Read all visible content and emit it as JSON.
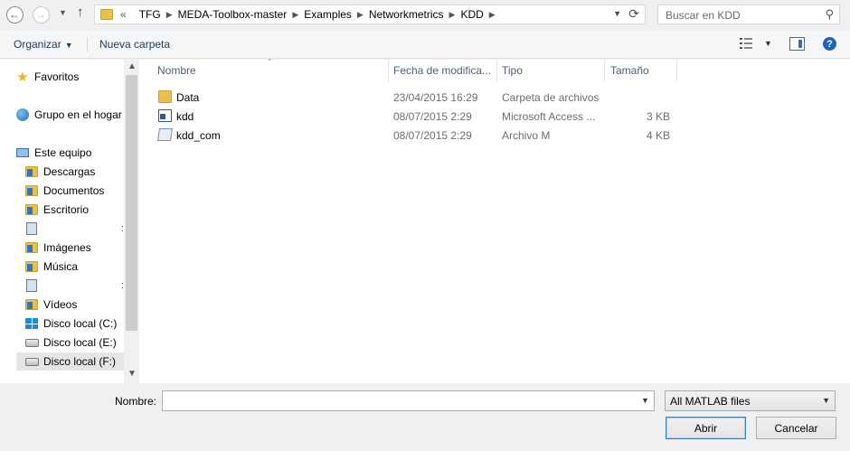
{
  "address_bar": {
    "overflow": "«",
    "crumbs": [
      "TFG",
      "MEDA-Toolbox-master",
      "Examples",
      "Networkmetrics",
      "KDD"
    ]
  },
  "search": {
    "placeholder": "Buscar en KDD"
  },
  "toolbar": {
    "organize_label": "Organizar",
    "new_folder_label": "Nueva carpeta"
  },
  "nav": {
    "favorites": "Favoritos",
    "homegroup": "Grupo en el hogar",
    "this_pc": "Este equipo",
    "items": [
      {
        "label": "Descargas",
        "icon": "downloads-folder-icon"
      },
      {
        "label": "Documentos",
        "icon": "documents-folder-icon"
      },
      {
        "label": "Escritorio",
        "icon": "desktop-folder-icon"
      },
      {
        "label": "",
        "icon": "network-location-icon"
      },
      {
        "label": "Imágenes",
        "icon": "pictures-folder-icon"
      },
      {
        "label": "Música",
        "icon": "music-folder-icon"
      },
      {
        "label": "",
        "icon": "network-location-icon"
      },
      {
        "label": "Vídeos",
        "icon": "videos-folder-icon"
      },
      {
        "label": "Disco local (C:)",
        "icon": "windows-drive-icon"
      },
      {
        "label": "Disco local (E:)",
        "icon": "drive-icon"
      },
      {
        "label": "Disco local (F:)",
        "icon": "drive-icon"
      }
    ]
  },
  "columns": {
    "name": "Nombre",
    "date": "Fecha de modifica...",
    "type": "Tipo",
    "size": "Tamaño"
  },
  "files": [
    {
      "name": "Data",
      "date": "23/04/2015 16:29",
      "type": "Carpeta de archivos",
      "size": "",
      "icon": "folder-icon"
    },
    {
      "name": "kdd",
      "date": "08/07/2015 2:29",
      "type": "Microsoft Access ...",
      "size": "3 KB",
      "icon": "access-file-icon"
    },
    {
      "name": "kdd_com",
      "date": "08/07/2015 2:29",
      "type": "Archivo M",
      "size": "4 KB",
      "icon": "m-file-icon"
    }
  ],
  "bottom": {
    "name_label": "Nombre:",
    "name_value": "",
    "filter": "All MATLAB files",
    "open_label": "Abrir",
    "cancel_label": "Cancelar"
  }
}
